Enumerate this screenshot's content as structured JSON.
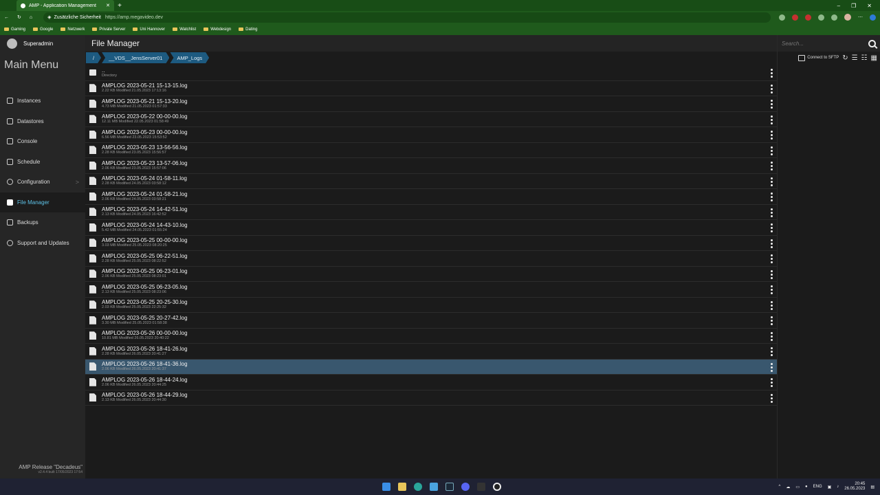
{
  "browser": {
    "tab_title": "AMP - Application Management",
    "security_label": "Zusätzliche Sicherheit",
    "url": "https://amp.megavideo.dev",
    "bookmarks": [
      "Gaming",
      "Google",
      "Netzwerk",
      "Private Server",
      "Uni Hannover",
      "Watchlist",
      "Webdesign",
      "Dating"
    ]
  },
  "sidebar": {
    "username": "Superadmin",
    "menu_title": "Main Menu",
    "items": [
      {
        "label": "Instances",
        "icon": "instances-icon"
      },
      {
        "label": "Datastores",
        "icon": "datastores-icon"
      },
      {
        "label": "Console",
        "icon": "console-icon"
      },
      {
        "label": "Schedule",
        "icon": "schedule-icon"
      },
      {
        "label": "Configuration",
        "icon": "gear-icon"
      },
      {
        "label": "File Manager",
        "icon": "file-icon"
      },
      {
        "label": "Backups",
        "icon": "backups-icon"
      },
      {
        "label": "Support and Updates",
        "icon": "lifebuoy-icon"
      }
    ],
    "active_item": "File Manager",
    "release": "AMP Release \"Decadeus\"",
    "build": "v2.4.4 built 17/05/2023 17:54"
  },
  "main": {
    "page_title": "File Manager",
    "breadcrumb": [
      "/",
      "__VDS__JensServer01",
      "AMP_Logs"
    ],
    "parent_dir": {
      "name": "..",
      "meta": "Directory"
    },
    "files": [
      {
        "name": "AMPLOG 2023-05-21 15-13-15.log",
        "meta": "2.22 KB Modified 21.05.2023 17:13:16"
      },
      {
        "name": "AMPLOG 2023-05-21 15-13-20.log",
        "meta": "4.73 MB Modified 21.05.2023 01:57:33"
      },
      {
        "name": "AMPLOG 2023-05-22 00-00-00.log",
        "meta": "12.11 MB Modified 22.05.2023 01:58:49"
      },
      {
        "name": "AMPLOG 2023-05-23 00-00-00.log",
        "meta": "6.56 MB Modified 23.05.2023 15:53:52"
      },
      {
        "name": "AMPLOG 2023-05-23 13-56-56.log",
        "meta": "2.28 KB Modified 23.05.2023 15:56:57"
      },
      {
        "name": "AMPLOG 2023-05-23 13-57-06.log",
        "meta": "2.06 KB Modified 23.05.2023 15:57:06"
      },
      {
        "name": "AMPLOG 2023-05-24 01-58-11.log",
        "meta": "2.28 KB Modified 24.05.2023 03:58:12"
      },
      {
        "name": "AMPLOG 2023-05-24 01-58-21.log",
        "meta": "2.06 KB Modified 24.05.2023 03:58:21"
      },
      {
        "name": "AMPLOG 2023-05-24 14-42-51.log",
        "meta": "2.13 KB Modified 24.05.2023 16:42:52"
      },
      {
        "name": "AMPLOG 2023-05-24 14-43-10.log",
        "meta": "5.42 MB Modified 24.05.2023 01:55:24"
      },
      {
        "name": "AMPLOG 2023-05-25 00-00-00.log",
        "meta": "3.03 MB Modified 25.05.2023 08:20:25"
      },
      {
        "name": "AMPLOG 2023-05-25 06-22-51.log",
        "meta": "2.28 KB Modified 25.05.2023 08:22:52"
      },
      {
        "name": "AMPLOG 2023-05-25 06-23-01.log",
        "meta": "2.06 KB Modified 25.05.2023 08:23:01"
      },
      {
        "name": "AMPLOG 2023-05-25 06-23-05.log",
        "meta": "2.13 KB Modified 25.05.2023 08:23:06"
      },
      {
        "name": "AMPLOG 2023-05-25 20-25-30.log",
        "meta": "2.03 KB Modified 25.05.2023 22:25:32"
      },
      {
        "name": "AMPLOG 2023-05-25 20-27-42.log",
        "meta": "3.30 MB Modified 25.05.2023 01:58:38"
      },
      {
        "name": "AMPLOG 2023-05-26 00-00-00.log",
        "meta": "10.81 MB Modified 26.05.2023 20:40:22"
      },
      {
        "name": "AMPLOG 2023-05-26 18-41-26.log",
        "meta": "2.28 KB Modified 26.05.2023 20:41:27"
      },
      {
        "name": "AMPLOG 2023-05-26 18-41-36.log",
        "meta": "2.06 KB Modified 26.05.2023 20:41:37"
      },
      {
        "name": "AMPLOG 2023-05-26 18-44-24.log",
        "meta": "2.06 KB Modified 26.05.2023 20:44:25"
      },
      {
        "name": "AMPLOG 2023-05-26 18-44-29.log",
        "meta": "2.13 KB Modified 26.05.2023 20:44:30"
      }
    ],
    "selected_index": 18
  },
  "rightpane": {
    "search_placeholder": "Search...",
    "sftp_label": "Connect to SFTP"
  },
  "taskbar": {
    "lang": "ENG",
    "time": "20:45",
    "date": "26.05.2023"
  },
  "colors": {
    "accent": "#1d5a80",
    "selected_row": "#39576e",
    "active_nav": "#5ec3e8",
    "browser": "#1f5a1c"
  }
}
